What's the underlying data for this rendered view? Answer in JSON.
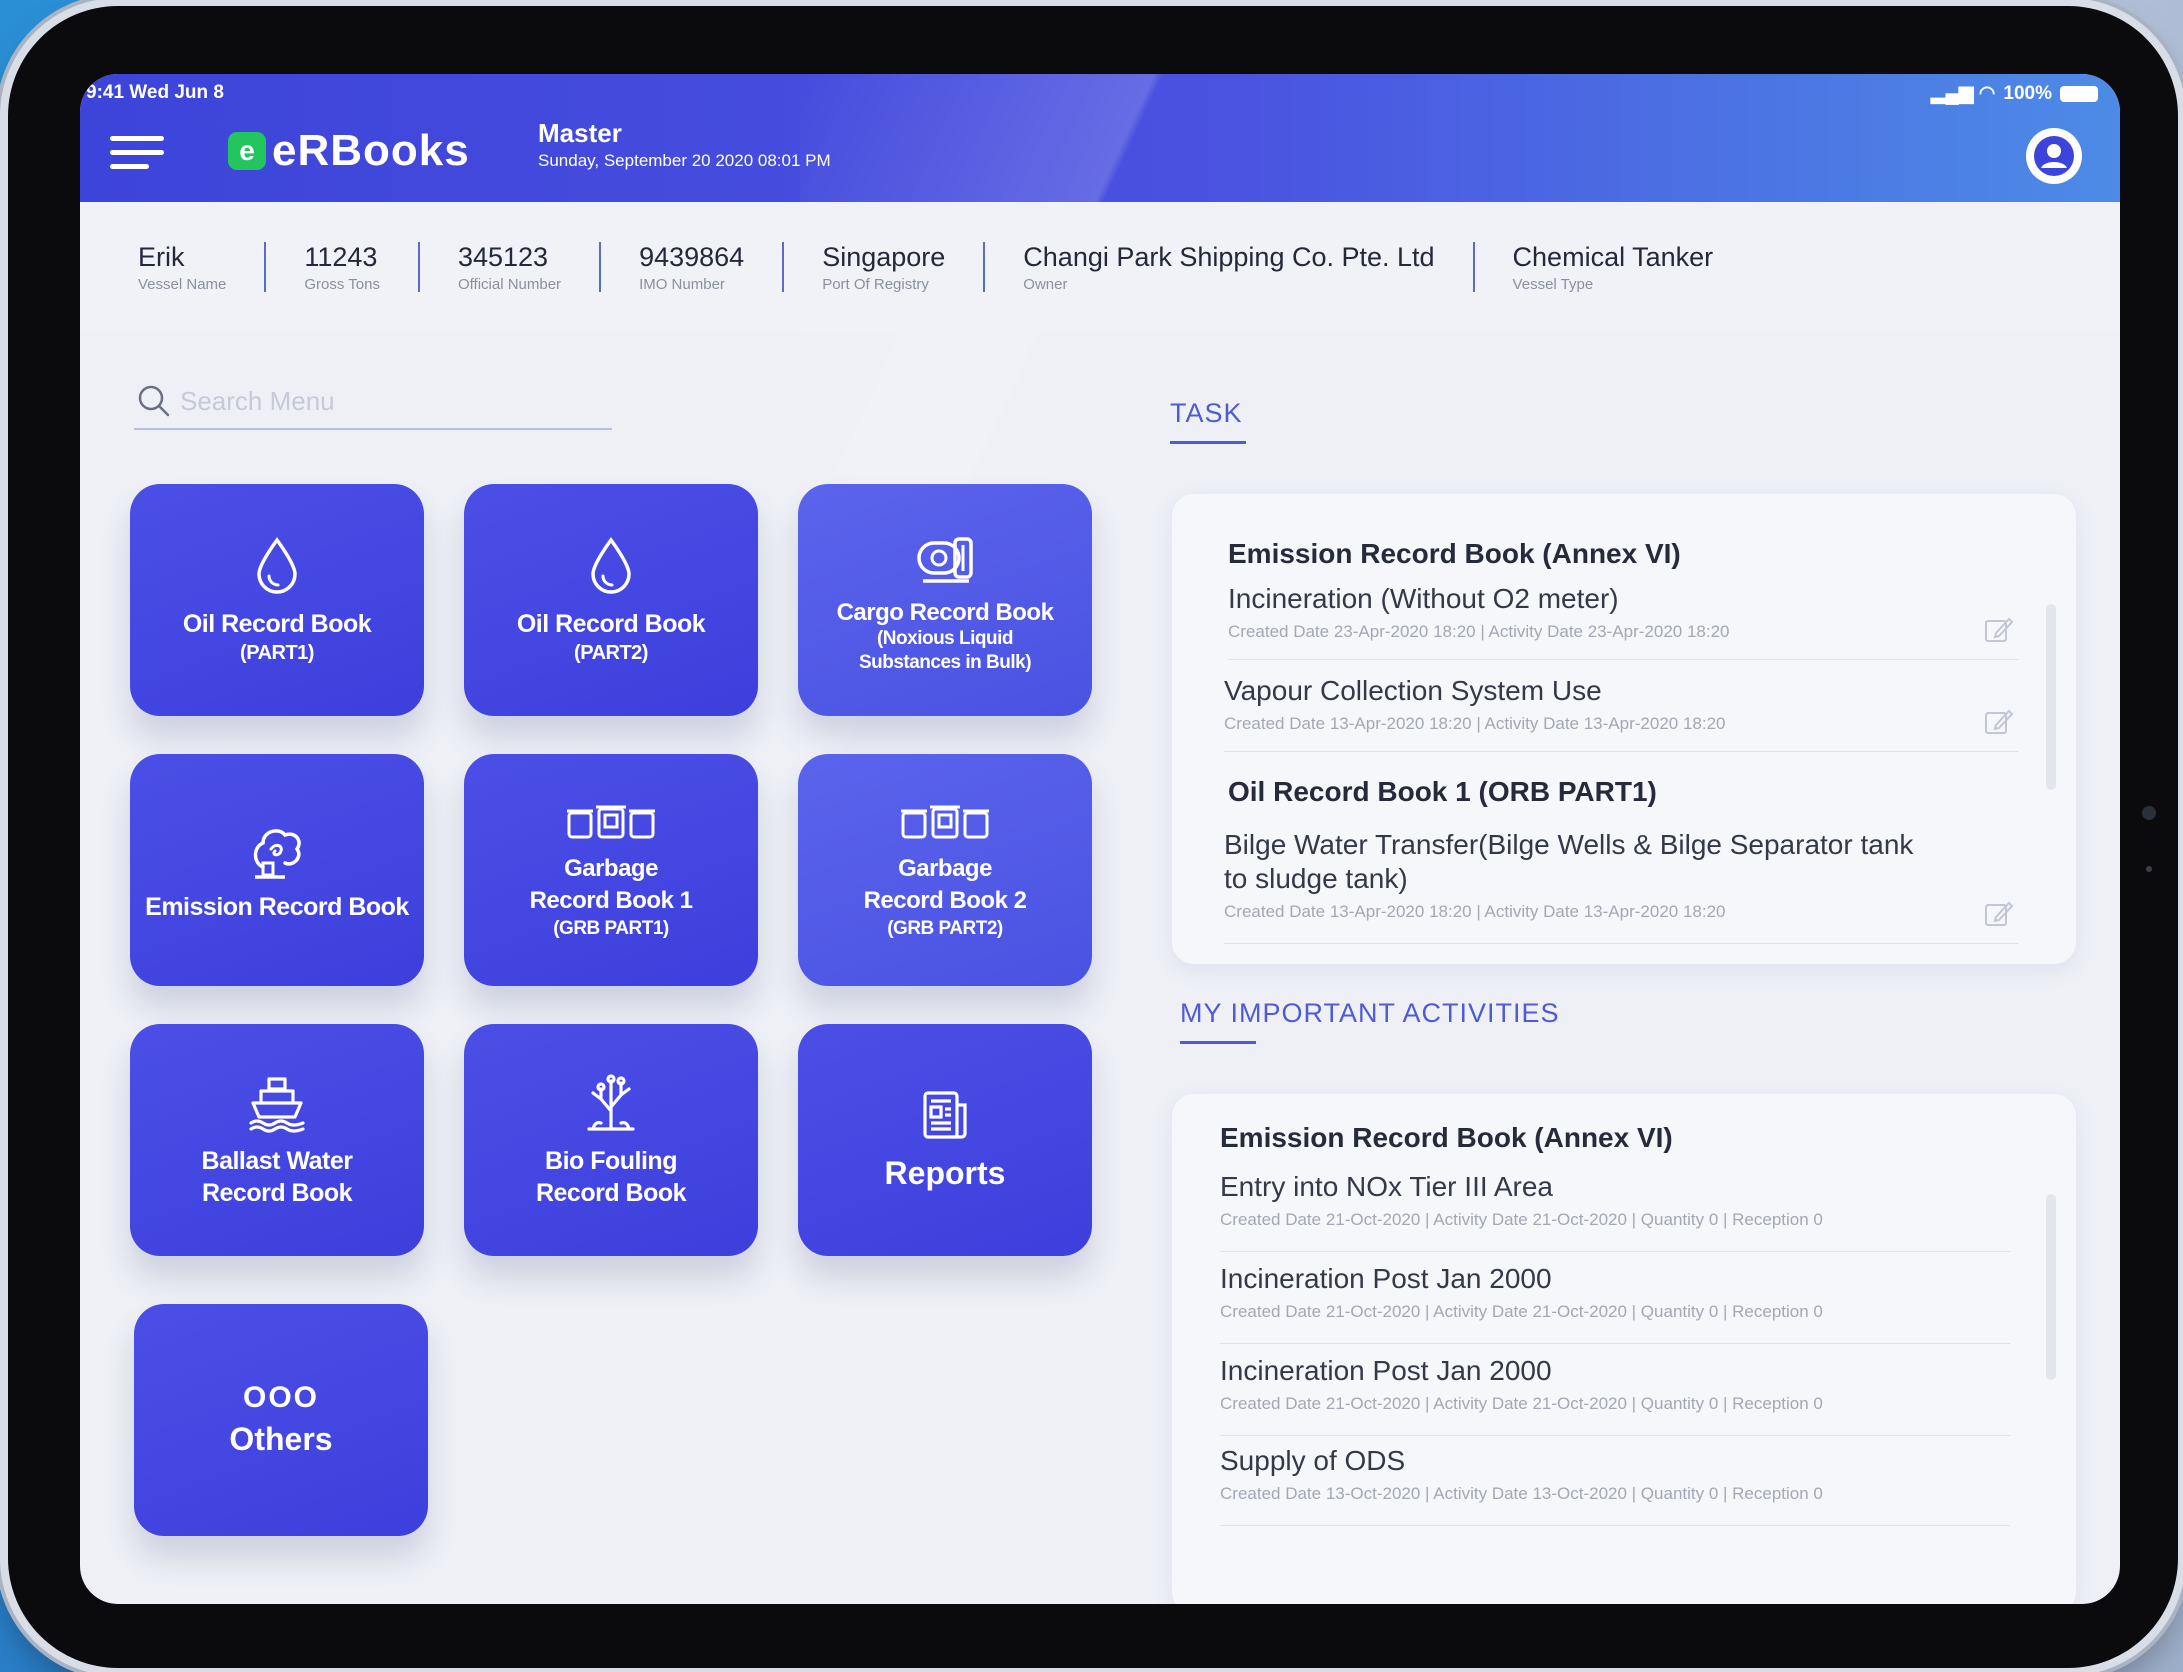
{
  "status_bar": {
    "time": "9:41 Wed Jun 8",
    "signal": "▂▄▆ ◠",
    "battery": "100%"
  },
  "header": {
    "logo_mark": "e",
    "app_name": "eRBooks",
    "role": "Master",
    "datetime": "Sunday, September 20 2020 08:01 PM"
  },
  "vessel": [
    {
      "value": "Erik",
      "label": "Vessel Name"
    },
    {
      "value": "11243",
      "label": "Gross Tons"
    },
    {
      "value": "345123",
      "label": "Official Number"
    },
    {
      "value": "9439864",
      "label": "IMO Number"
    },
    {
      "value": "Singapore",
      "label": "Port Of Registry"
    },
    {
      "value": "Changi Park Shipping Co. Pte. Ltd",
      "label": "Owner"
    },
    {
      "value": "Chemical Tanker",
      "label": "Vessel Type"
    }
  ],
  "search": {
    "placeholder": "Search Menu"
  },
  "tiles": [
    {
      "icon": "drop-icon",
      "line1": "Oil Record Book",
      "line2": "(PART1)"
    },
    {
      "icon": "drop-icon",
      "line1": "Oil Record Book",
      "line2": "(PART2)"
    },
    {
      "icon": "tanker-icon",
      "line1": "Cargo Record Book",
      "line2": "(Noxious Liquid",
      "line3": "Substances in Bulk)"
    },
    {
      "icon": "emission-icon",
      "line1": "Emission Record Book"
    },
    {
      "icon": "garbage-bins-icon",
      "line1": "Garbage",
      "line2": "Record Book 1",
      "line3": "(GRB PART1)"
    },
    {
      "icon": "garbage-bins-icon",
      "line1": "Garbage",
      "line2": "Record Book 2",
      "line3": "(GRB PART2)"
    },
    {
      "icon": "ship-icon",
      "line1": "Ballast Water",
      "line2": "Record Book"
    },
    {
      "icon": "coral-icon",
      "line1": "Bio Fouling",
      "line2": "Record Book"
    },
    {
      "icon": "report-icon",
      "line1": "Reports"
    },
    {
      "icon": "more-dots-icon",
      "line1": "Others",
      "dots": "OOO"
    }
  ],
  "task": {
    "title": "TASK",
    "groups": [
      {
        "title": "Emission Record Book (Annex VI)",
        "entries": [
          {
            "title": "Incineration (Without O2 meter)",
            "meta": "Created Date 23-Apr-2020 18:20 | Activity Date 23-Apr-2020 18:20"
          },
          {
            "title": "Vapour Collection System Use",
            "meta": "Created Date 13-Apr-2020 18:20 | Activity Date 13-Apr-2020 18:20"
          }
        ]
      },
      {
        "title": "Oil Record Book 1 (ORB PART1)",
        "entries": [
          {
            "title": "Bilge Water Transfer(Bilge Wells & Bilge Separator tank",
            "title2": "to sludge tank)",
            "meta": "Created Date 13-Apr-2020 18:20 | Activity Date 13-Apr-2020 18:20"
          }
        ]
      }
    ]
  },
  "activities": {
    "title": "MY IMPORTANT ACTIVITIES",
    "group_title": "Emission Record Book (Annex VI)",
    "entries": [
      {
        "title": "Entry into NOx Tier III Area",
        "meta": "Created Date 21-Oct-2020 | Activity Date 21-Oct-2020 | Quantity 0 | Reception 0"
      },
      {
        "title": "Incineration Post Jan 2000",
        "meta": "Created Date 21-Oct-2020 | Activity Date 21-Oct-2020 | Quantity 0 | Reception 0"
      },
      {
        "title": "Incineration Post Jan 2000",
        "meta": "Created Date 21-Oct-2020 | Activity Date 21-Oct-2020 | Quantity 0 | Reception 0"
      },
      {
        "title": "Supply of ODS",
        "meta": "Created Date 13-Oct-2020 | Activity Date 13-Oct-2020 | Quantity 0 | Reception 0"
      }
    ]
  },
  "colors": {
    "primary": "#3d3fdc",
    "accent": "#4f5bd5",
    "brand_green": "#22c55e"
  }
}
